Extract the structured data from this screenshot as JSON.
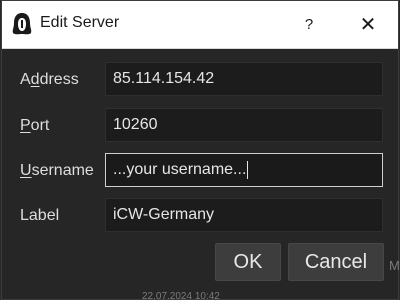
{
  "window": {
    "title": "Edit Server",
    "help_label": "?",
    "close_label": "✕"
  },
  "form": {
    "address": {
      "label_access": "A",
      "label_underlined": "d",
      "label_rest": "dress",
      "value": "85.114.154.42"
    },
    "port": {
      "label_underlined": "P",
      "label_rest": "ort",
      "value": "10260"
    },
    "username": {
      "label_underlined": "U",
      "label_rest": "sername",
      "value": "...your username..."
    },
    "label": {
      "label_text": "Label",
      "value": "iCW-Germany"
    }
  },
  "buttons": {
    "ok": "OK",
    "cancel": "Cancel"
  },
  "background": {
    "partial_text": "22.07.2024 10:42",
    "edge_char": "M"
  },
  "colors": {
    "dialog_bg": "#262626",
    "field_bg": "#1c1c1c",
    "titlebar_bg": "#ffffff",
    "button_bg": "#3d3d3d"
  }
}
